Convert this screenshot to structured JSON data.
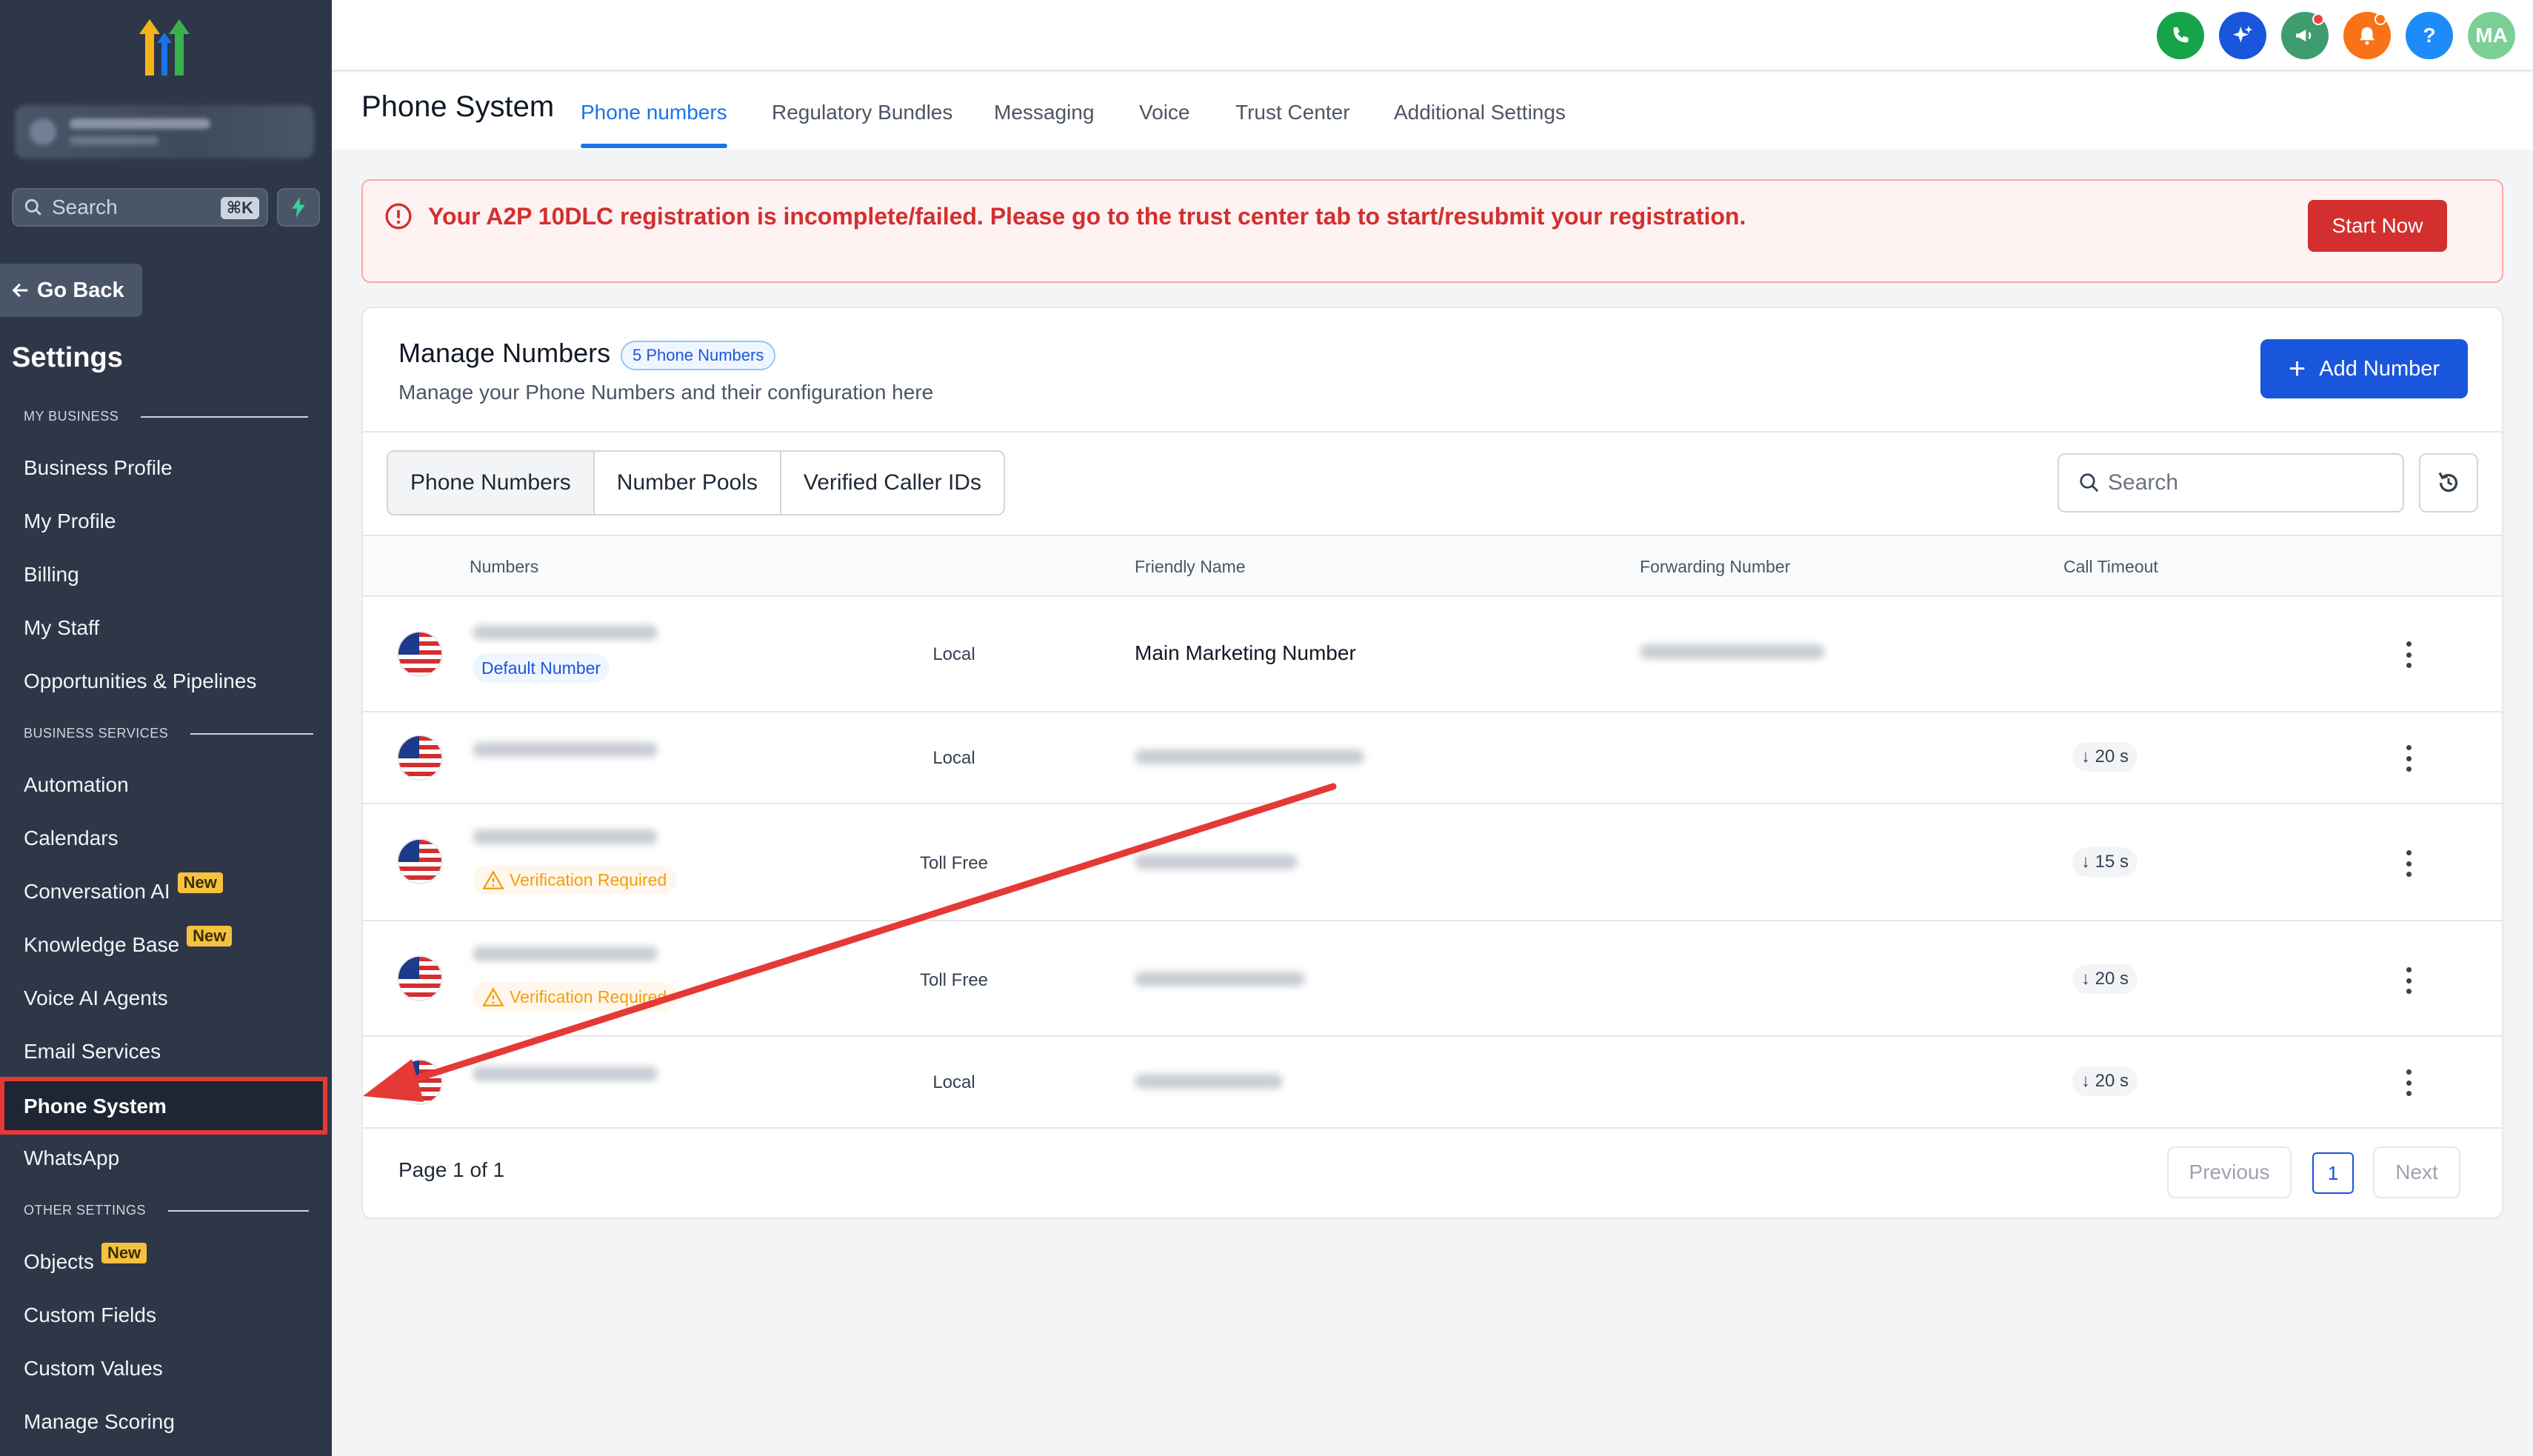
{
  "sidebar": {
    "search_placeholder": "Search",
    "search_shortcut": "⌘K",
    "go_back": "Go Back",
    "settings_title": "Settings",
    "section_my_business": "MY BUSINESS",
    "section_business_services": "BUSINESS SERVICES",
    "section_other_settings": "OTHER SETTINGS",
    "new_badge": "New",
    "items": {
      "business_profile": "Business Profile",
      "my_profile": "My Profile",
      "billing": "Billing",
      "my_staff": "My Staff",
      "opportunities": "Opportunities & Pipelines",
      "automation": "Automation",
      "calendars": "Calendars",
      "conversation_ai": "Conversation AI",
      "knowledge_base": "Knowledge Base",
      "voice_ai_agents": "Voice AI Agents",
      "email_services": "Email Services",
      "phone_system": "Phone System",
      "whatsapp": "WhatsApp",
      "objects": "Objects",
      "custom_fields": "Custom Fields",
      "custom_values": "Custom Values",
      "manage_scoring": "Manage Scoring"
    }
  },
  "topbar": {
    "avatar_initials": "MA",
    "help": "?"
  },
  "subnav": {
    "page_title": "Phone System",
    "tabs": [
      "Phone numbers",
      "Regulatory Bundles",
      "Messaging",
      "Voice",
      "Trust Center",
      "Additional Settings"
    ]
  },
  "alert": {
    "message": "Your A2P 10DLC registration is incomplete/failed. Please go to the trust center tab to start/resubmit your registration.",
    "button": "Start Now"
  },
  "card": {
    "title": "Manage Numbers",
    "count_badge": "5 Phone Numbers",
    "subtitle": "Manage your Phone Numbers and their configuration here",
    "add_button": "Add Number",
    "segments": [
      "Phone Numbers",
      "Number Pools",
      "Verified Caller IDs"
    ],
    "search_placeholder": "Search",
    "columns": {
      "numbers": "Numbers",
      "friendly_name": "Friendly Name",
      "forwarding_number": "Forwarding Number",
      "call_timeout": "Call Timeout"
    },
    "rows": [
      {
        "type": "Local",
        "friendly_name": "Main Marketing Number",
        "pill": "Default Number",
        "timeout": ""
      },
      {
        "type": "Local",
        "friendly_name": "",
        "pill": "",
        "timeout": "20 s"
      },
      {
        "type": "Toll Free",
        "friendly_name": "",
        "pill": "Verification Required",
        "timeout": "15 s"
      },
      {
        "type": "Toll Free",
        "friendly_name": "",
        "pill": "Verification Required",
        "timeout": "20 s"
      },
      {
        "type": "Local",
        "friendly_name": "",
        "pill": "",
        "timeout": "20 s"
      }
    ],
    "pagination": {
      "info": "Page 1 of 1",
      "previous": "Previous",
      "current": "1",
      "next": "Next"
    }
  },
  "colors": {
    "sidebar_bg": "#2d3748",
    "primary": "#1a56db",
    "alert_red": "#d32f2f",
    "annotation_red": "#e53935"
  }
}
